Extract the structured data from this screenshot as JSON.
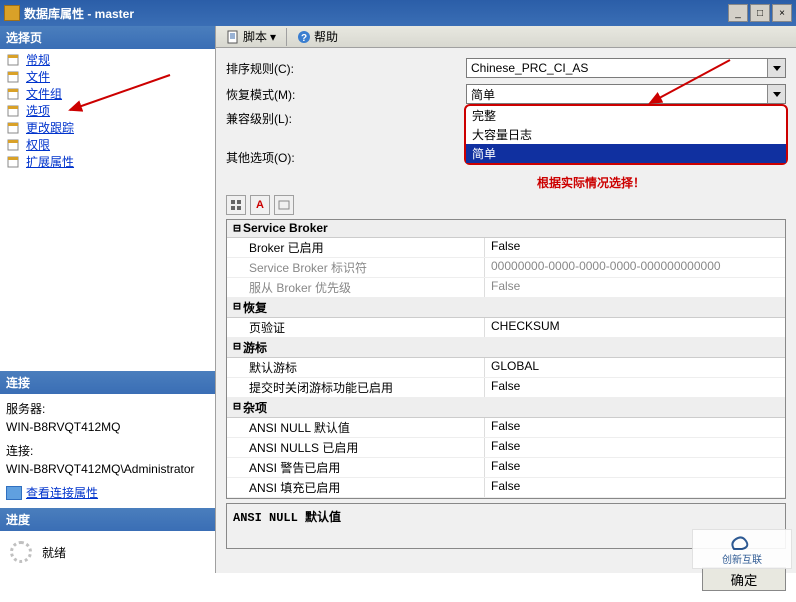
{
  "window": {
    "title": "数据库属性 - master",
    "min": "_",
    "max": "□",
    "close": "×"
  },
  "sidebar": {
    "select_header": "选择页",
    "items": [
      {
        "label": "常规"
      },
      {
        "label": "文件"
      },
      {
        "label": "文件组"
      },
      {
        "label": "选项"
      },
      {
        "label": "更改跟踪"
      },
      {
        "label": "权限"
      },
      {
        "label": "扩展属性"
      }
    ],
    "conn_header": "连接",
    "server_label": "服务器:",
    "server_value": "WIN-B8RVQT412MQ",
    "conn_label": "连接:",
    "conn_value": "WIN-B8RVQT412MQ\\Administrator",
    "view_link": "查看连接属性",
    "progress_header": "进度",
    "progress_status": "就绪"
  },
  "toolbar": {
    "script": "脚本",
    "help": "帮助"
  },
  "form": {
    "collation_label": "排序规则(C):",
    "collation_value": "Chinese_PRC_CI_AS",
    "recovery_label": "恢复模式(M):",
    "recovery_value": "简单",
    "compat_label": "兼容级别(L):",
    "other_label": "其他选项(O):"
  },
  "dropdown": {
    "opt1": "完整",
    "opt2": "大容量日志",
    "opt3": "简单"
  },
  "annotation": "根据实际情况选择！",
  "grid": {
    "cat_broker": "Service Broker",
    "broker_enabled_k": "Broker 已启用",
    "broker_enabled_v": "False",
    "broker_id_k": "Service Broker 标识符",
    "broker_id_v": "00000000-0000-0000-0000-000000000000",
    "broker_pri_k": "服从 Broker 优先级",
    "broker_pri_v": "False",
    "cat_recovery": "恢复",
    "page_verify_k": "页验证",
    "page_verify_v": "CHECKSUM",
    "cat_cursor": "游标",
    "cursor_def_k": "默认游标",
    "cursor_def_v": "GLOBAL",
    "cursor_close_k": "提交时关闭游标功能已启用",
    "cursor_close_v": "False",
    "cat_misc": "杂项",
    "ansi_null_def_k": "ANSI NULL 默认值",
    "ansi_null_def_v": "False",
    "ansi_nulls_k": "ANSI NULLS 已启用",
    "ansi_nulls_v": "False",
    "ansi_warn_k": "ANSI 警告已启用",
    "ansi_warn_v": "False",
    "ansi_pad_k": "ANSI 填充已启用",
    "ansi_pad_v": "False"
  },
  "desc": "ANSI NULL 默认值",
  "buttons": {
    "ok": "确定"
  },
  "logo": {
    "l1": "创新互联"
  }
}
